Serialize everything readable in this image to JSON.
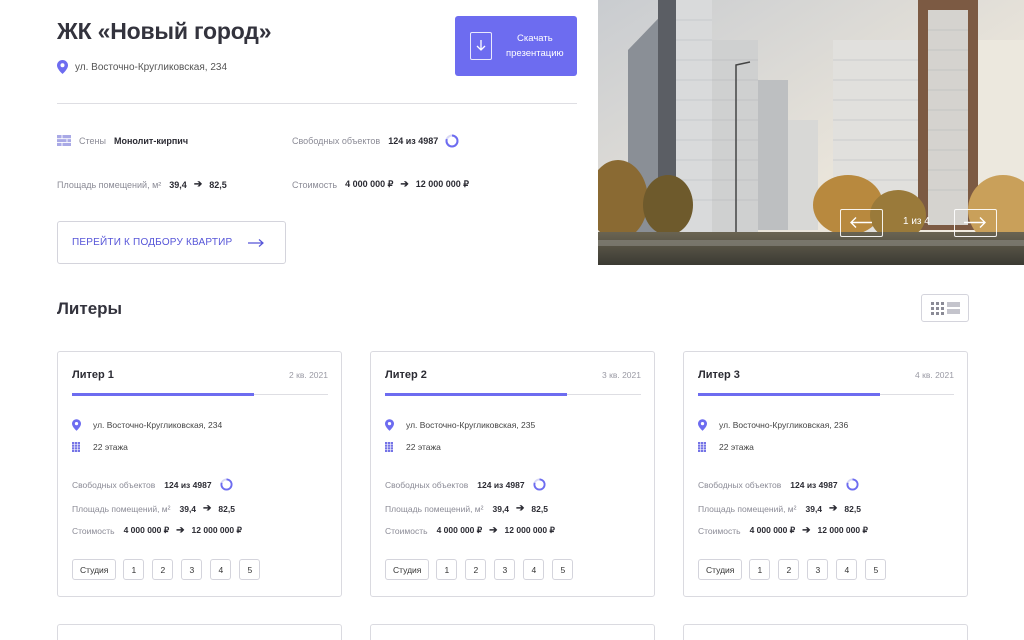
{
  "complex": {
    "title": "ЖК «Новый город»",
    "address": "ул. Восточно-Кругликовская, 234"
  },
  "download": {
    "line1": "Скачать",
    "line2": "презентацию"
  },
  "facts": {
    "walls_label": "Стены",
    "walls_value": "Монолит-кирпич",
    "free_label": "Свободных объектов",
    "free_value": "124 из 4987",
    "free_fraction": 0.8,
    "area_label": "Площадь помещений, м²",
    "area_min": "39,4",
    "area_max": "82,5",
    "price_label": "Стоимость",
    "price_min": "4 000 000 ₽",
    "price_max": "12 000 000 ₽"
  },
  "pick_button": "ПЕРЕЙТИ К ПОДБОРУ КВАРТИР",
  "gallery": {
    "counter": "1 из 4"
  },
  "section_title": "Литеры",
  "colors": {
    "accent": "#6d6cf0",
    "text": "#2b2b33",
    "muted": "#8b8b96",
    "border": "#dadae0"
  },
  "liters": [
    {
      "name": "Литер 1",
      "date": "2 кв. 2021",
      "address": "ул. Восточно-Кругликовская, 234",
      "floors": "22 этажа",
      "free_label": "Свободных объектов",
      "free_value": "124 из 4987",
      "area_label": "Площадь помещений, м²",
      "area_min": "39,4",
      "area_max": "82,5",
      "price_label": "Стоимость",
      "price_min": "4 000 000 ₽",
      "price_max": "12 000 000 ₽",
      "progress": 0.71,
      "rooms": [
        "Студия",
        "1",
        "2",
        "3",
        "4",
        "5"
      ]
    },
    {
      "name": "Литер 2",
      "date": "3 кв. 2021",
      "address": "ул. Восточно-Кругликовская, 235",
      "floors": "22 этажа",
      "free_label": "Свободных объектов",
      "free_value": "124 из 4987",
      "area_label": "Площадь помещений, м²",
      "area_min": "39,4",
      "area_max": "82,5",
      "price_label": "Стоимость",
      "price_min": "4 000 000 ₽",
      "price_max": "12 000 000 ₽",
      "progress": 0.71,
      "rooms": [
        "Студия",
        "1",
        "2",
        "3",
        "4",
        "5"
      ]
    },
    {
      "name": "Литер 3",
      "date": "4 кв. 2021",
      "address": "ул. Восточно-Кругликовская, 236",
      "floors": "22 этажа",
      "free_label": "Свободных объектов",
      "free_value": "124 из 4987",
      "area_label": "Площадь помещений, м²",
      "area_min": "39,4",
      "area_max": "82,5",
      "price_label": "Стоимость",
      "price_min": "4 000 000 ₽",
      "price_max": "12 000 000 ₽",
      "progress": 0.71,
      "rooms": [
        "Студия",
        "1",
        "2",
        "3",
        "4",
        "5"
      ]
    }
  ]
}
